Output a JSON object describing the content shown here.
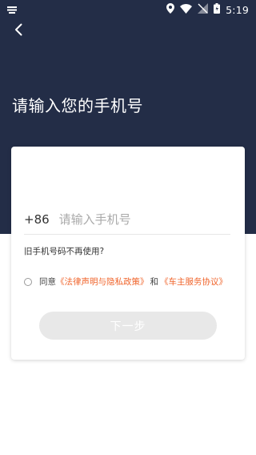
{
  "status_bar": {
    "time": "5:19",
    "icons": [
      "notification-icon",
      "location-icon",
      "wifi-icon",
      "signal-icon",
      "battery-icon"
    ]
  },
  "header": {
    "back_icon": "chevron-left-icon",
    "title": "请输入您的手机号"
  },
  "form": {
    "country_code": "+86",
    "phone_placeholder": "请输入手机号",
    "phone_value": "",
    "old_phone_link": "旧手机号码不再使用?",
    "agreement": {
      "prefix": "同意",
      "legal_policy": "《法律声明与隐私政策》",
      "conjunction": "和",
      "service_agreement": "《车主服务协议》",
      "checked": false
    },
    "next_button": "下一步",
    "next_button_enabled": false
  },
  "colors": {
    "header_bg": "#232d47",
    "link_orange": "#f0642b",
    "button_disabled_bg": "#e8e8e8"
  }
}
